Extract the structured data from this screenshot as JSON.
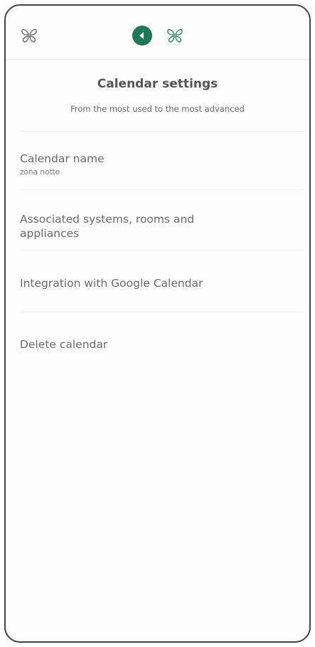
{
  "header": {
    "title": "Calendar settings",
    "subtitle": "From the most used to the most advanced"
  },
  "menu": {
    "calendar_name_label": "Calendar name",
    "calendar_name_value": "zona notte",
    "associated_label": "Associated systems, rooms and appliances",
    "google_label": "Integration with Google Calendar",
    "delete_label": "Delete calendar"
  },
  "colors": {
    "accent": "#1b7a55",
    "logo_left": "#666666",
    "logo_center": "#2a8a60"
  }
}
